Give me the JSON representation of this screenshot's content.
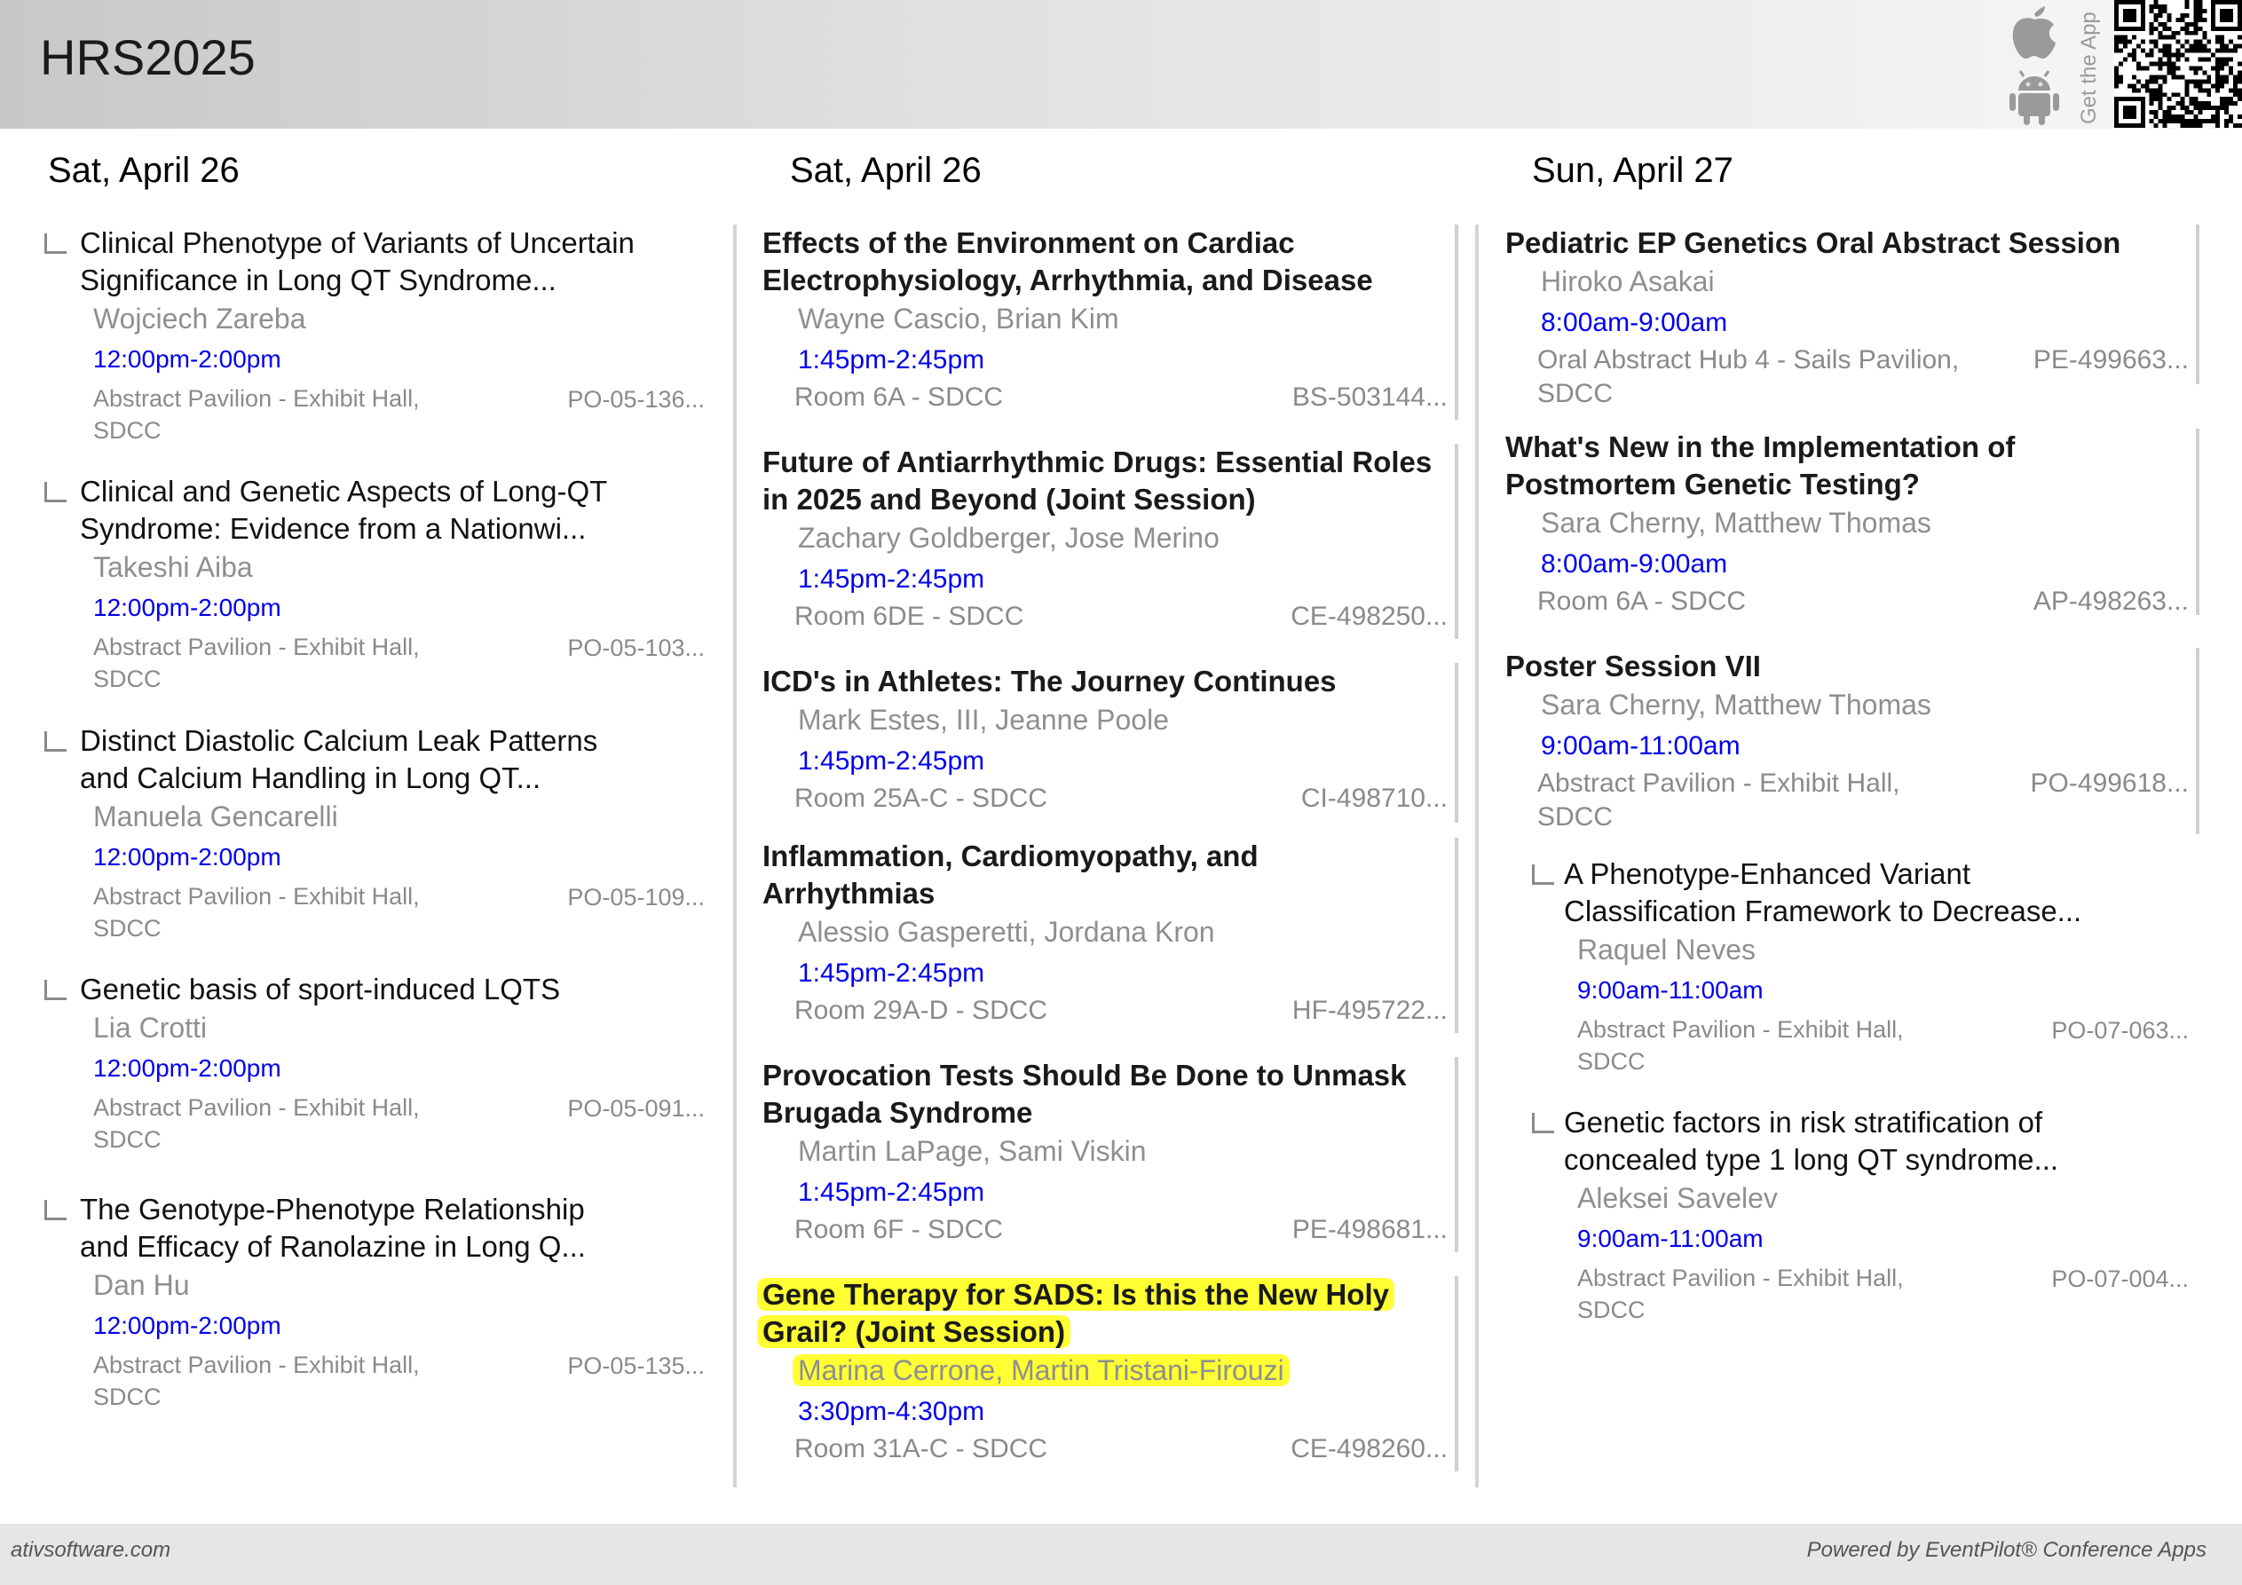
{
  "header": {
    "app_title": "HRS2025",
    "get_app_label": "Get the App",
    "icons": [
      "apple-icon",
      "android-icon",
      "qr-code"
    ]
  },
  "columns": [
    {
      "day": "Sat, April 26"
    },
    {
      "day": "Sat, April 26"
    },
    {
      "day": "Sun, April 27"
    }
  ],
  "col1": [
    {
      "title1": "Clinical Phenotype of Variants of Uncertain",
      "title2": "Significance in Long QT Syndrome...",
      "speaker": "Wojciech Zareba",
      "time": "12:00pm-2:00pm",
      "loc1": "Abstract Pavilion - Exhibit Hall,",
      "loc2": "SDCC",
      "code": "PO-05-136..."
    },
    {
      "title1": "Clinical and Genetic Aspects of Long-QT",
      "title2": "Syndrome: Evidence from a Nationwi...",
      "speaker": "Takeshi Aiba",
      "time": "12:00pm-2:00pm",
      "loc1": "Abstract Pavilion - Exhibit Hall,",
      "loc2": "SDCC",
      "code": "PO-05-103..."
    },
    {
      "title1": "Distinct Diastolic Calcium Leak Patterns",
      "title2": "and Calcium Handling in Long QT...",
      "speaker": "Manuela Gencarelli",
      "time": "12:00pm-2:00pm",
      "loc1": "Abstract Pavilion - Exhibit Hall,",
      "loc2": "SDCC",
      "code": "PO-05-109..."
    },
    {
      "title1": "Genetic basis of sport-induced LQTS",
      "title2": "",
      "speaker": "Lia Crotti",
      "time": "12:00pm-2:00pm",
      "loc1": "Abstract Pavilion - Exhibit Hall,",
      "loc2": "SDCC",
      "code": "PO-05-091..."
    },
    {
      "title1": "The Genotype-Phenotype Relationship",
      "title2": "and Efficacy of Ranolazine in Long Q...",
      "speaker": "Dan Hu",
      "time": "12:00pm-2:00pm",
      "loc1": "Abstract Pavilion - Exhibit Hall,",
      "loc2": "SDCC",
      "code": "PO-05-135..."
    }
  ],
  "col2": [
    {
      "title1": "Effects of the Environment on Cardiac",
      "title2": "Electrophysiology, Arrhythmia, and Disease",
      "speaker": "Wayne Cascio, Brian Kim",
      "time": "1:45pm-2:45pm",
      "loc": "Room 6A - SDCC",
      "code": "BS-503144..."
    },
    {
      "title1": "Future of Antiarrhythmic Drugs: Essential Roles",
      "title2": "in 2025 and Beyond (Joint Session)",
      "speaker": "Zachary Goldberger, Jose Merino",
      "time": "1:45pm-2:45pm",
      "loc": "Room 6DE - SDCC",
      "code": "CE-498250..."
    },
    {
      "title1": "ICD's in Athletes: The Journey Continues",
      "title2": "",
      "speaker": "Mark Estes, III, Jeanne Poole",
      "time": "1:45pm-2:45pm",
      "loc": "Room 25A-C - SDCC",
      "code": "CI-498710..."
    },
    {
      "title1": "Inflammation, Cardiomyopathy, and",
      "title2": "Arrhythmias",
      "speaker": "Alessio Gasperetti, Jordana Kron",
      "time": "1:45pm-2:45pm",
      "loc": "Room 29A-D - SDCC",
      "code": "HF-495722..."
    },
    {
      "title1": "Provocation Tests Should Be Done to Unmask",
      "title2": "Brugada Syndrome",
      "speaker": "Martin LaPage, Sami Viskin",
      "time": "1:45pm-2:45pm",
      "loc": "Room 6F - SDCC",
      "code": "PE-498681..."
    },
    {
      "title1": "Gene Therapy for SADS: Is this the New Holy",
      "title2": "Grail? (Joint Session)",
      "speaker": "Marina Cerrone, Martin Tristani-Firouzi",
      "time": "3:30pm-4:30pm",
      "loc": "Room 31A-C - SDCC",
      "code": "CE-498260...",
      "highlight_color": "#ffff33"
    }
  ],
  "col3_sessions": [
    {
      "title1": "Pediatric EP Genetics Oral Abstract Session",
      "title2": "",
      "speaker": "Hiroko Asakai",
      "time": "8:00am-9:00am",
      "loc1": "Oral Abstract Hub 4 - Sails Pavilion,",
      "loc2": "SDCC",
      "code": "PE-499663..."
    },
    {
      "title1": "What's New in the Implementation of",
      "title2": "Postmortem Genetic Testing?",
      "speaker": "Sara Cherny, Matthew Thomas",
      "time": "8:00am-9:00am",
      "loc1": "Room 6A - SDCC",
      "loc2": "",
      "code": "AP-498263..."
    },
    {
      "title1": "Poster Session VII",
      "title2": "",
      "speaker": "Sara Cherny, Matthew Thomas",
      "time": "9:00am-11:00am",
      "loc1": "Abstract Pavilion - Exhibit Hall,",
      "loc2": "SDCC",
      "code": "PO-499618..."
    }
  ],
  "col3_children": [
    {
      "title1": "A Phenotype-Enhanced Variant",
      "title2": "Classification Framework to Decrease...",
      "speaker": "Raquel Neves",
      "time": "9:00am-11:00am",
      "loc1": "Abstract Pavilion - Exhibit Hall,",
      "loc2": "SDCC",
      "code": "PO-07-063..."
    },
    {
      "title1": "Genetic factors in risk stratification of",
      "title2": "concealed type 1 long QT syndrome...",
      "speaker": "Aleksei Savelev",
      "time": "9:00am-11:00am",
      "loc1": "Abstract Pavilion - Exhibit Hall,",
      "loc2": "SDCC",
      "code": "PO-07-004..."
    }
  ],
  "footer": {
    "left": "ativsoftware.com",
    "right": "Powered by EventPilot® Conference Apps"
  },
  "colors": {
    "time_link": "#0000ee",
    "highlight": "#ffff33",
    "muted": "#8a8a8a"
  }
}
